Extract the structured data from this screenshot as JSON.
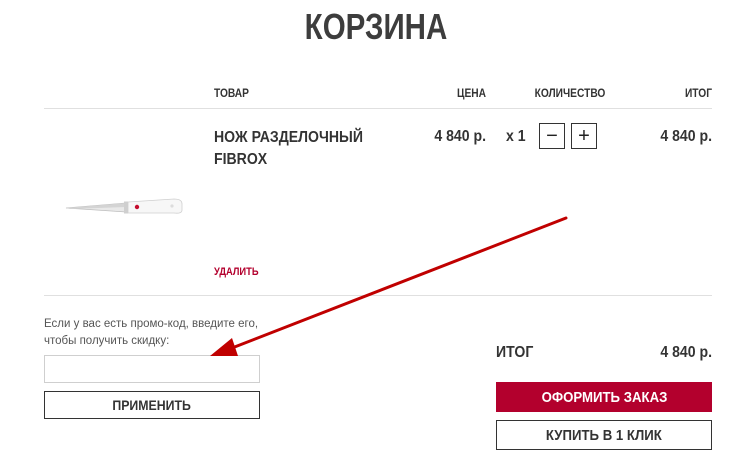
{
  "page": {
    "title": "КОРЗИНА"
  },
  "table": {
    "headers": {
      "product": "ТОВАР",
      "price": "ЦЕНА",
      "quantity": "КОЛИЧЕСТВО",
      "total": "ИТОГ"
    }
  },
  "cart_item": {
    "name_line1": "НОЖ РАЗДЕЛОЧНЫЙ",
    "name_line2": "FIBROX",
    "price": "4 840 р.",
    "qty_prefix": "x 1",
    "minus_label": "−",
    "plus_label": "+",
    "line_total": "4 840 р.",
    "delete_label": "УДАЛИТЬ",
    "image_icon": "chef-knife-icon"
  },
  "promo": {
    "hint_line1": "Если у вас есть промо-код, введите его,",
    "hint_line2": "чтобы получить скидку:",
    "input_value": "",
    "placeholder": "",
    "apply_label": "ПРИМЕНИТЬ"
  },
  "summary": {
    "total_label": "ИТОГ",
    "total_value": "4 840 р.",
    "checkout_label": "ОФОРМИТЬ ЗАКАЗ",
    "one_click_label": "КУПИТЬ В 1 КЛИК"
  },
  "colors": {
    "accent": "#b3002d",
    "text": "#333333",
    "divider": "#e0e0e0",
    "annotation_arrow": "#c00000"
  }
}
